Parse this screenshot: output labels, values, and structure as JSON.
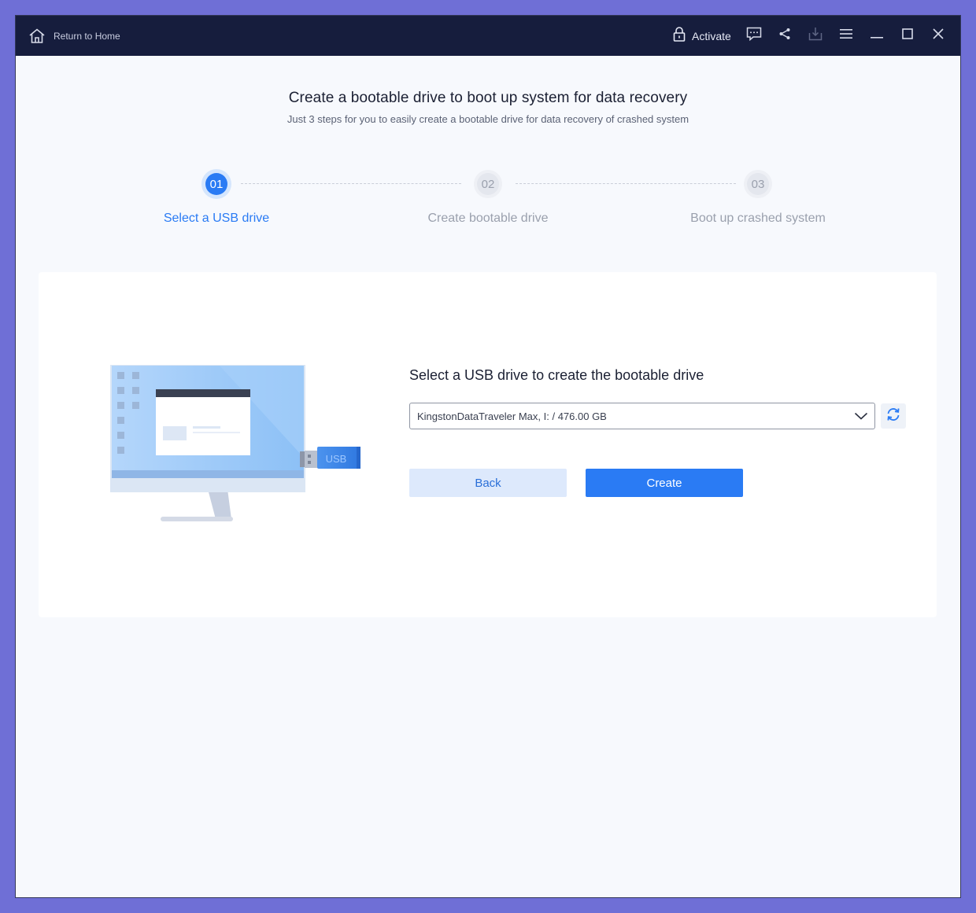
{
  "titlebar": {
    "home_label": "Return to Home",
    "activate_label": "Activate",
    "icons": [
      "home-icon",
      "lock-icon",
      "feedback-icon",
      "share-icon",
      "download-icon",
      "menu-icon",
      "minimize-icon",
      "maximize-icon",
      "close-icon"
    ]
  },
  "header": {
    "title": "Create a bootable drive to boot up system for data recovery",
    "subtitle": "Just 3 steps for you to easily create a bootable drive for data recovery of crashed system"
  },
  "steps": [
    {
      "number": "01",
      "label": "Select a USB drive",
      "state": "active"
    },
    {
      "number": "02",
      "label": "Create bootable drive",
      "state": "inactive"
    },
    {
      "number": "03",
      "label": "Boot up crashed system",
      "state": "inactive"
    }
  ],
  "panel": {
    "section_title": "Select a USB drive to create the bootable drive",
    "selected_drive": "KingstonDataTraveler Max, I: / 476.00 GB",
    "back_label": "Back",
    "create_label": "Create",
    "usb_text": "USB"
  },
  "colors": {
    "accent": "#2a7bf4",
    "titlebar": "#161d3d",
    "background": "#f7f9fd"
  }
}
